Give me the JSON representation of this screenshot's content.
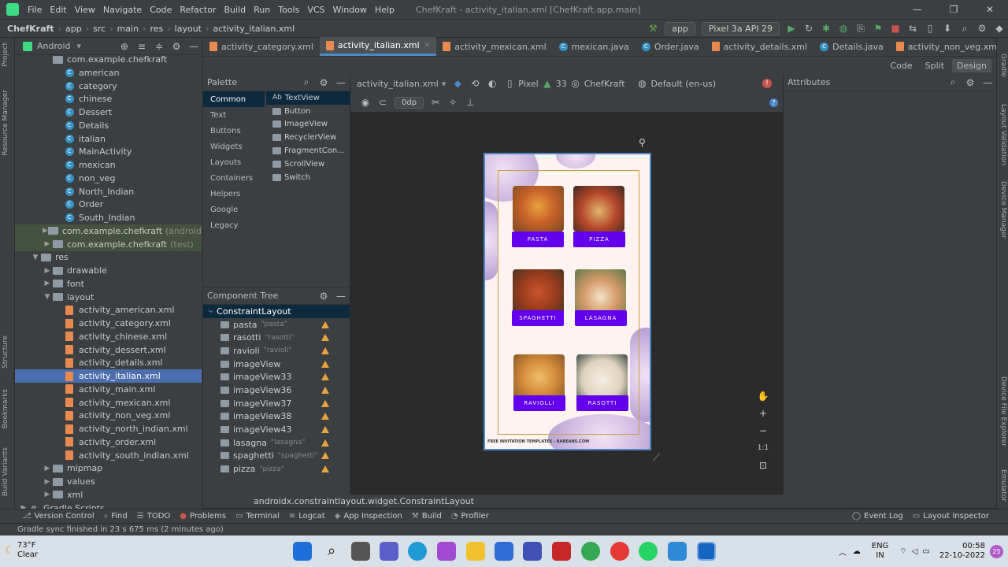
{
  "menubar": {
    "items": [
      "File",
      "Edit",
      "View",
      "Navigate",
      "Code",
      "Refactor",
      "Build",
      "Run",
      "Tools",
      "VCS",
      "Window",
      "Help"
    ],
    "title": "ChefKraft - activity_italian.xml [ChefKraft.app.main]"
  },
  "navbar": {
    "crumbs": [
      "ChefKraft",
      "app",
      "src",
      "main",
      "res",
      "layout",
      "activity_italian.xml"
    ],
    "run_config": "app",
    "device": "Pixel 3a API 29"
  },
  "project_panel": {
    "view_label": "Android",
    "items": [
      {
        "label": "com.example.chefkraft",
        "type": "package",
        "indent": 3,
        "arrow": ""
      },
      {
        "label": "american",
        "type": "class",
        "indent": 4
      },
      {
        "label": "category",
        "type": "class",
        "indent": 4
      },
      {
        "label": "chinese",
        "type": "class",
        "indent": 4
      },
      {
        "label": "Dessert",
        "type": "class",
        "indent": 4
      },
      {
        "label": "Details",
        "type": "class",
        "indent": 4
      },
      {
        "label": "italian",
        "type": "class",
        "indent": 4
      },
      {
        "label": "MainActivity",
        "type": "class",
        "indent": 4
      },
      {
        "label": "mexican",
        "type": "class",
        "indent": 4
      },
      {
        "label": "non_veg",
        "type": "class",
        "indent": 4
      },
      {
        "label": "North_Indian",
        "type": "class",
        "indent": 4
      },
      {
        "label": "Order",
        "type": "class",
        "indent": 4
      },
      {
        "label": "South_Indian",
        "type": "class",
        "indent": 4
      },
      {
        "label": "com.example.chefkraft",
        "suffix": "(androidTest)",
        "type": "package",
        "indent": 3,
        "arrow": "▶",
        "green": true
      },
      {
        "label": "com.example.chefkraft",
        "suffix": "(test)",
        "type": "package",
        "indent": 3,
        "arrow": "▶",
        "green": true
      },
      {
        "label": "res",
        "type": "folder",
        "indent": 2,
        "arrow": "▼"
      },
      {
        "label": "drawable",
        "type": "folder",
        "indent": 3,
        "arrow": "▶"
      },
      {
        "label": "font",
        "type": "folder",
        "indent": 3,
        "arrow": "▶"
      },
      {
        "label": "layout",
        "type": "folder",
        "indent": 3,
        "arrow": "▼"
      },
      {
        "label": "activity_american.xml",
        "type": "xml",
        "indent": 4
      },
      {
        "label": "activity_category.xml",
        "type": "xml",
        "indent": 4
      },
      {
        "label": "activity_chinese.xml",
        "type": "xml",
        "indent": 4
      },
      {
        "label": "activity_dessert.xml",
        "type": "xml",
        "indent": 4
      },
      {
        "label": "activity_details.xml",
        "type": "xml",
        "indent": 4
      },
      {
        "label": "activity_italian.xml",
        "type": "xml",
        "indent": 4,
        "selected": true
      },
      {
        "label": "activity_main.xml",
        "type": "xml",
        "indent": 4
      },
      {
        "label": "activity_mexican.xml",
        "type": "xml",
        "indent": 4
      },
      {
        "label": "activity_non_veg.xml",
        "type": "xml",
        "indent": 4
      },
      {
        "label": "activity_north_indian.xml",
        "type": "xml",
        "indent": 4
      },
      {
        "label": "activity_order.xml",
        "type": "xml",
        "indent": 4
      },
      {
        "label": "activity_south_indian.xml",
        "type": "xml",
        "indent": 4
      },
      {
        "label": "mipmap",
        "type": "folder",
        "indent": 3,
        "arrow": "▶"
      },
      {
        "label": "values",
        "type": "folder",
        "indent": 3,
        "arrow": "▶"
      },
      {
        "label": "xml",
        "type": "folder",
        "indent": 3,
        "arrow": "▶"
      },
      {
        "label": "Gradle Scripts",
        "type": "gradle",
        "indent": 1,
        "arrow": "▶"
      }
    ]
  },
  "editor_tabs": [
    {
      "label": "activity_category.xml",
      "type": "xml"
    },
    {
      "label": "activity_italian.xml",
      "type": "xml",
      "active": true
    },
    {
      "label": "activity_mexican.xml",
      "type": "xml"
    },
    {
      "label": "mexican.java",
      "type": "class"
    },
    {
      "label": "Order.java",
      "type": "class"
    },
    {
      "label": "activity_details.xml",
      "type": "xml"
    },
    {
      "label": "Details.java",
      "type": "class"
    },
    {
      "label": "activity_non_veg.xml",
      "type": "xml"
    }
  ],
  "mode": {
    "code": "Code",
    "split": "Split",
    "design": "Design"
  },
  "palette": {
    "title": "Palette",
    "categories": [
      "Common",
      "Text",
      "Buttons",
      "Widgets",
      "Layouts",
      "Containers",
      "Helpers",
      "Google",
      "Legacy"
    ],
    "items": [
      "TextView",
      "Button",
      "ImageView",
      "RecyclerView",
      "FragmentCon...",
      "ScrollView",
      "Switch"
    ]
  },
  "component_tree": {
    "title": "Component Tree",
    "root": "ConstraintLayout",
    "items": [
      {
        "label": "pasta",
        "hint": "\"pasta\""
      },
      {
        "label": "rasotti",
        "hint": "\"rasotti\""
      },
      {
        "label": "ravioli",
        "hint": "\"ravioli\""
      },
      {
        "label": "imageView",
        "hint": ""
      },
      {
        "label": "imageView33",
        "hint": ""
      },
      {
        "label": "imageView36",
        "hint": ""
      },
      {
        "label": "imageView37",
        "hint": ""
      },
      {
        "label": "imageView38",
        "hint": ""
      },
      {
        "label": "imageView43",
        "hint": ""
      },
      {
        "label": "lasagna",
        "hint": "\"lasagna\""
      },
      {
        "label": "spaghetti",
        "hint": "\"spaghetti\""
      },
      {
        "label": "pizza",
        "hint": "\"pizza\""
      }
    ]
  },
  "design_toolbar": {
    "file": "activity_italian.xml",
    "device": "Pixel",
    "api": "33",
    "theme": "ChefKraft",
    "locale": "Default (en-us)",
    "margin": "0dp"
  },
  "attributes": {
    "title": "Attributes"
  },
  "preview": {
    "buttons": [
      "PASTA",
      "PIZZA",
      "SPAGHETTI",
      "LASAGNA",
      "RAVIOLLI",
      "RASOTTI"
    ],
    "footer": "FREE INVITATION TEMPLATES - BAREANS.COM"
  },
  "status_path": "androidx.constraintlayout.widget.ConstraintLayout",
  "tool_windows": [
    "Version Control",
    "Find",
    "TODO",
    "Problems",
    "Terminal",
    "Logcat",
    "App Inspection",
    "Build",
    "Profiler"
  ],
  "tool_windows_right": [
    "Event Log",
    "Layout Inspector"
  ],
  "status_message": "Gradle sync finished in 23 s 675 ms (2 minutes ago)",
  "left_strip": [
    "Project",
    "Resource Manager",
    "Structure",
    "Bookmarks",
    "Build Variants"
  ],
  "right_strip": [
    "Gradle",
    "Layout Validation",
    "Device Manager",
    "Device File Explorer",
    "Emulator"
  ],
  "taskbar": {
    "temperature": "73°F",
    "condition": "Clear",
    "lang": "ENG",
    "region": "IN",
    "time": "00:58",
    "date": "22-10-2022",
    "badge": "25"
  },
  "colors": {
    "accent": "#4a88c7",
    "button_purple": "#6200ee",
    "warning": "#e8a33e",
    "selected": "#4b6eaf"
  }
}
